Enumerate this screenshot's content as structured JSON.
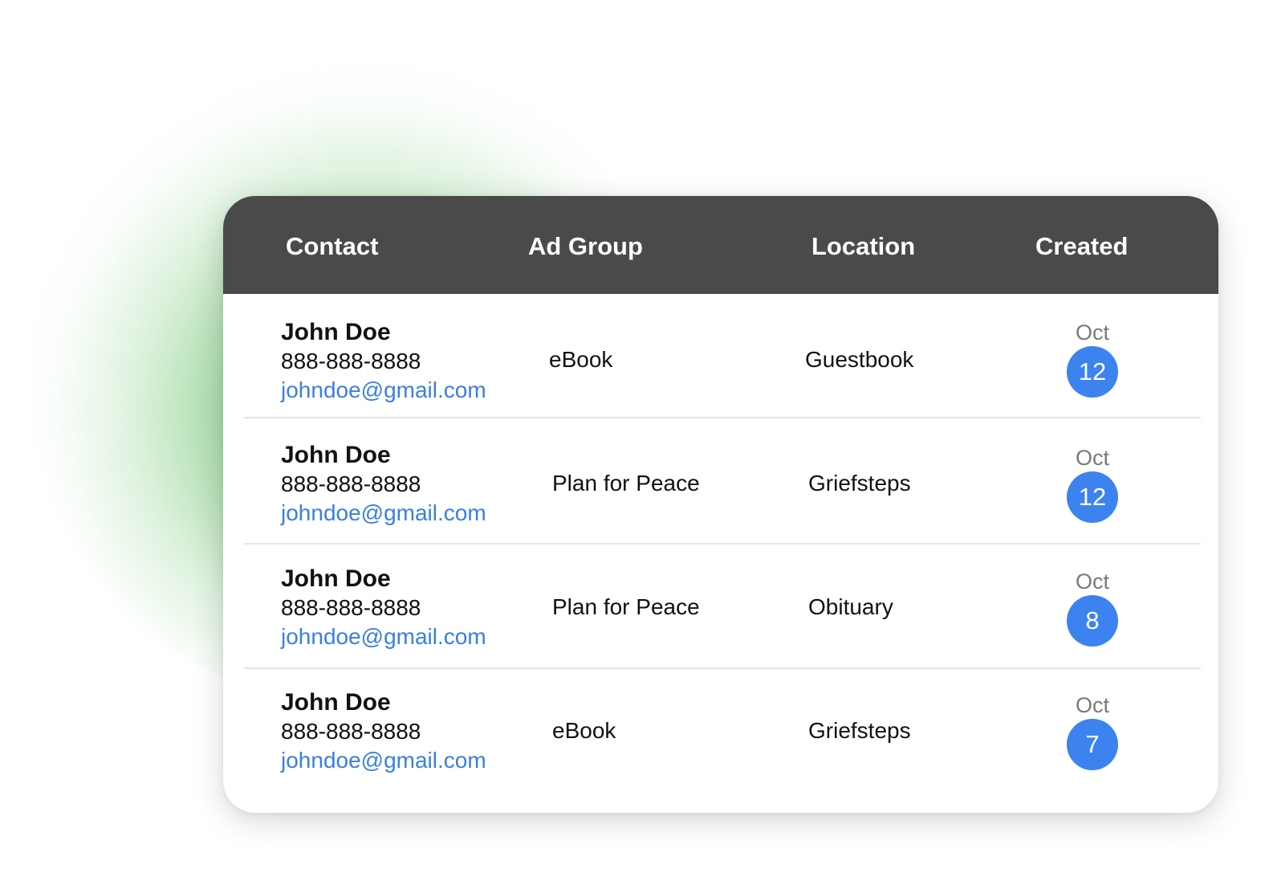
{
  "table": {
    "headers": {
      "contact": "Contact",
      "ad_group": "Ad Group",
      "location": "Location",
      "created": "Created"
    },
    "rows": [
      {
        "name": "John Doe",
        "phone": "888-888-8888",
        "email": "johndoe@gmail.com",
        "ad_group": "eBook",
        "location": "Guestbook",
        "month": "Oct",
        "day": "12"
      },
      {
        "name": "John Doe",
        "phone": "888-888-8888",
        "email": "johndoe@gmail.com",
        "ad_group": "Plan for Peace",
        "location": "Griefsteps",
        "month": "Oct",
        "day": "12"
      },
      {
        "name": "John Doe",
        "phone": "888-888-8888",
        "email": "johndoe@gmail.com",
        "ad_group": "Plan for Peace",
        "location": "Obituary",
        "month": "Oct",
        "day": "8"
      },
      {
        "name": "John Doe",
        "phone": "888-888-8888",
        "email": "johndoe@gmail.com",
        "ad_group": "eBook",
        "location": "Griefsteps",
        "month": "Oct",
        "day": "7"
      }
    ]
  },
  "colors": {
    "header_bg": "#4a4a4a",
    "email_link": "#3a7fe0",
    "day_badge": "#3c83f0",
    "glow": "#48b248"
  }
}
